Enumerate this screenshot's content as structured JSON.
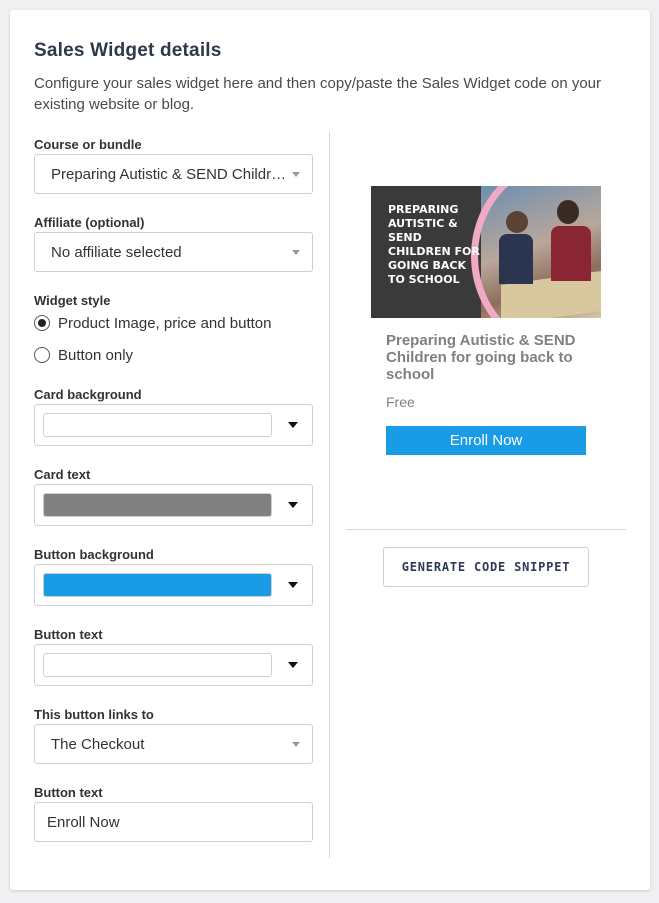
{
  "header": {
    "title": "Sales Widget details",
    "description": "Configure your sales widget here and then copy/paste the Sales Widget code on your existing website or blog."
  },
  "form": {
    "course": {
      "label": "Course or bundle",
      "value": "Preparing Autistic & SEND Children for going back to school"
    },
    "affiliate": {
      "label": "Affiliate (optional)",
      "value": "No affiliate selected"
    },
    "widget_style": {
      "label": "Widget style",
      "options": [
        {
          "label": "Product Image, price and button",
          "selected": true
        },
        {
          "label": "Button only",
          "selected": false
        }
      ]
    },
    "card_background": {
      "label": "Card background",
      "color": "#ffffff"
    },
    "card_text": {
      "label": "Card text",
      "color": "#808080"
    },
    "button_background": {
      "label": "Button background",
      "color": "#1a9be6"
    },
    "button_text_color": {
      "label": "Button text",
      "color": "#ffffff"
    },
    "links_to": {
      "label": "This button links to",
      "value": "The Checkout"
    },
    "button_text": {
      "label": "Button text",
      "value": "Enroll Now"
    }
  },
  "preview": {
    "image_text": "PREPARING AUTISTIC & SEND CHILDREN FOR GOING BACK TO SCHOOL",
    "course_title": "Preparing Autistic & SEND Children for going back to school",
    "price": "Free",
    "button_label": "Enroll Now"
  },
  "actions": {
    "generate_label": "GENERATE CODE SNIPPET"
  },
  "colors": {
    "accent_blue": "#1a9be6",
    "card_text_gray": "#808080",
    "pink_ring": "#f2a9c4"
  },
  "icons": [
    "dropdown-caret-icon",
    "color-picker-arrow-icon",
    "radio-icon"
  ]
}
